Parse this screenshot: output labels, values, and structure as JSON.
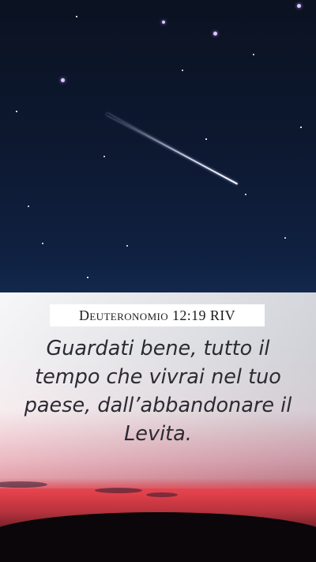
{
  "verse_card": {
    "reference": "Deuteronomio 12:19 RIV",
    "text": "Guardati bene, tutto il tempo che vivrai nel tuo paese, dall’abbandonare il Levita."
  },
  "colors": {
    "sky_top": "#0b1221",
    "sky_bottom": "#12284c",
    "panel_white": "#f4f4f6",
    "sunset_red": "#e24a52",
    "text_dark": "#2c2a33"
  }
}
